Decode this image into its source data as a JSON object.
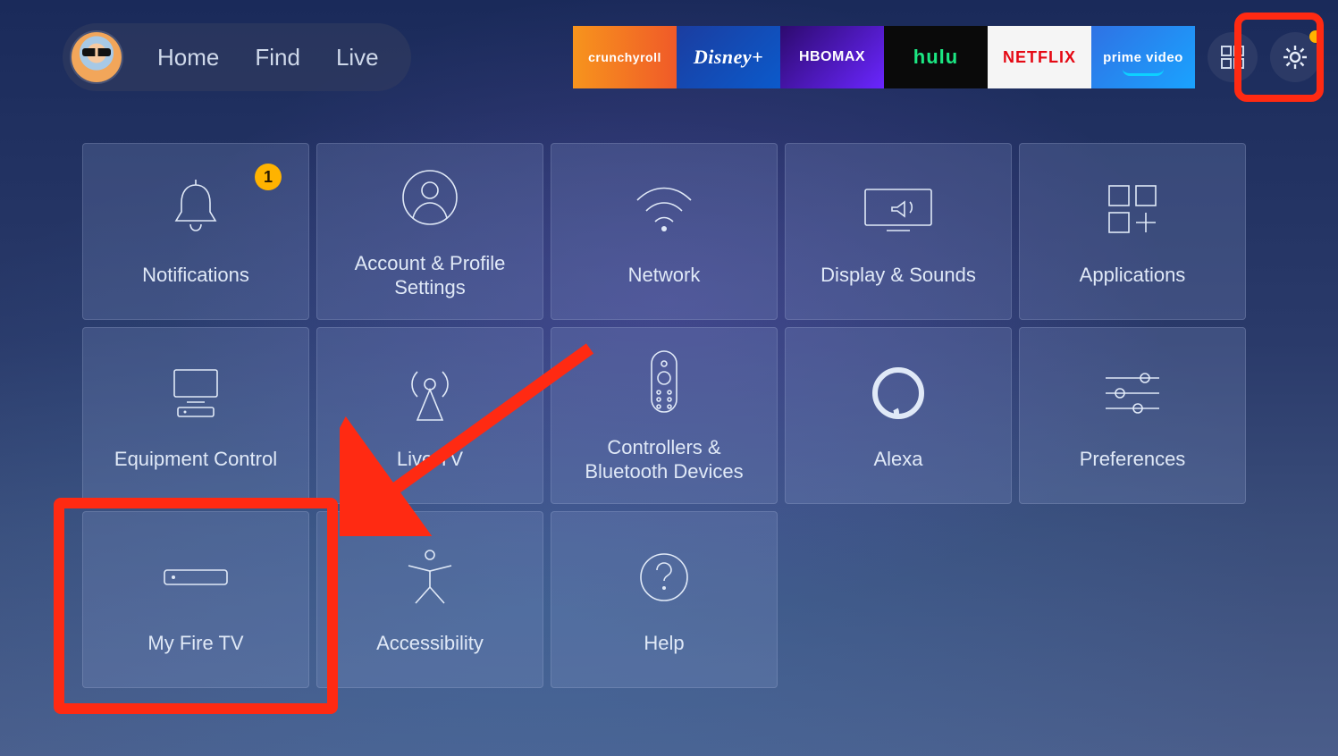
{
  "nav": {
    "home": "Home",
    "find": "Find",
    "live": "Live",
    "apps": {
      "crunchyroll": "crunchyroll",
      "disney": "Disney+",
      "hbomax": "HBOMAX",
      "hulu": "hulu",
      "netflix": "NETFLIX",
      "prime": "prime video"
    }
  },
  "tiles": {
    "notifications": "Notifications",
    "notifications_badge": "1",
    "account": "Account & Profile Settings",
    "network": "Network",
    "display": "Display & Sounds",
    "applications": "Applications",
    "equipment": "Equipment Control",
    "livetv": "Live TV",
    "controllers": "Controllers & Bluetooth Devices",
    "alexa": "Alexa",
    "preferences": "Preferences",
    "myfiretv": "My Fire TV",
    "accessibility": "Accessibility",
    "help": "Help"
  }
}
